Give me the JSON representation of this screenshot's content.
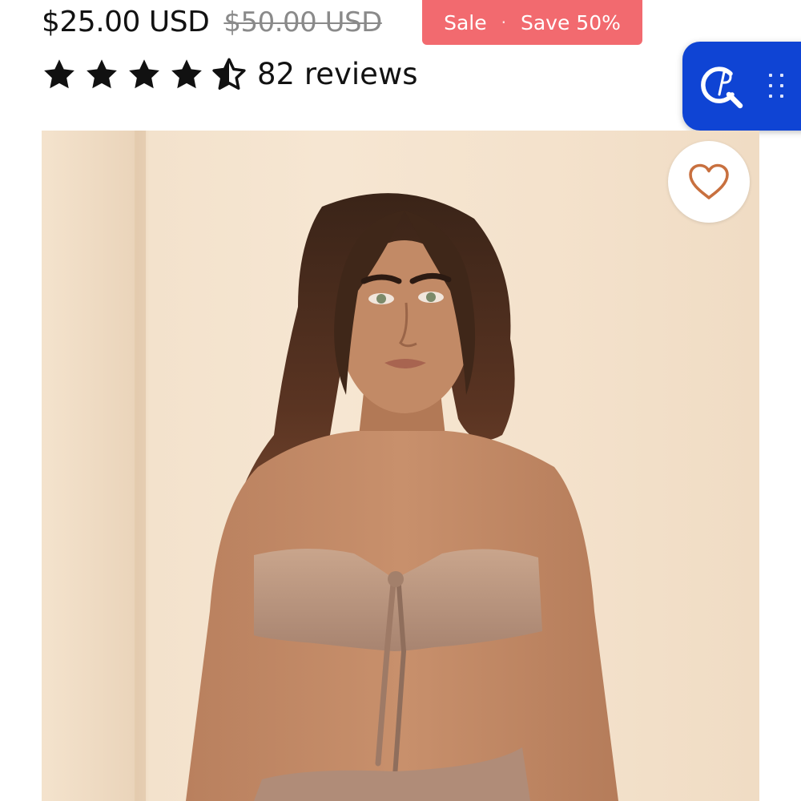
{
  "product": {
    "price": "$25.00 USD",
    "compare_price": "$50.00 USD",
    "badge": {
      "sale_label": "Sale",
      "separator": "·",
      "save_label": "Save 50%",
      "color": "#f26a6f"
    },
    "rating": {
      "stars_filled": 4,
      "stars_half": 1,
      "stars_total": 5,
      "reviews_text": "82 reviews"
    }
  },
  "widget": {
    "icon": "search-icon",
    "grip_icon": "drag-handle-icon",
    "color": "#0f44d4"
  },
  "gallery": {
    "image_icon": "product-photo",
    "wishlist_icon": "heart-icon",
    "wishlist_color": "#c8703f"
  }
}
